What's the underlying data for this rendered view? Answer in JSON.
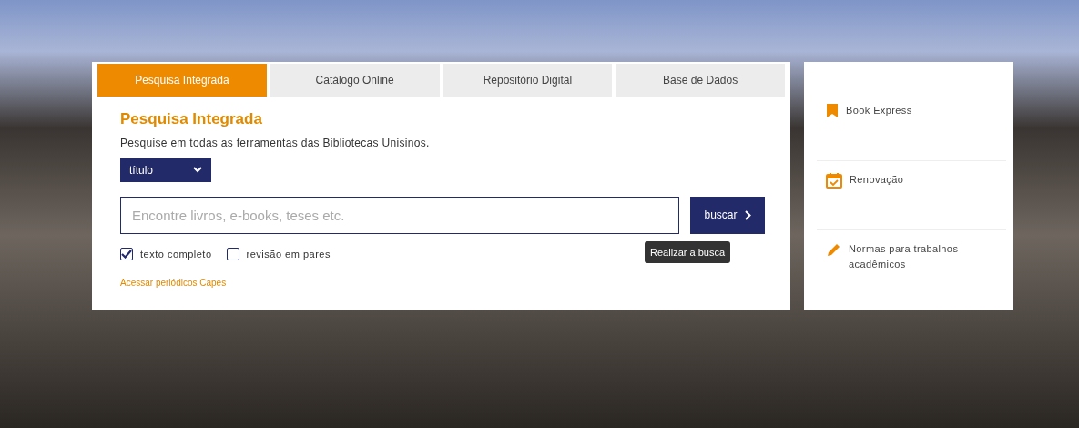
{
  "tabs": [
    {
      "label": "Pesquisa Integrada",
      "selected": true
    },
    {
      "label": "Catálogo Online",
      "selected": false
    },
    {
      "label": "Repositório Digital",
      "selected": false
    },
    {
      "label": "Base de Dados",
      "selected": false
    }
  ],
  "search": {
    "title": "Pesquisa Integrada",
    "description": "Pesquise em todas as ferramentas das Bibliotecas Unisinos.",
    "field_select": "título",
    "placeholder": "Encontre livros, e-books, teses etc.",
    "button": "buscar",
    "tooltip": "Realizar a busca",
    "filters": [
      {
        "label": "texto completo",
        "checked": true
      },
      {
        "label": "revisão em pares",
        "checked": false
      }
    ],
    "link": "Acessar periódicos Capes"
  },
  "quick_links": [
    {
      "kind": "bookmark",
      "label": "Book Express"
    },
    {
      "kind": "calendar",
      "label": "Renovação"
    },
    {
      "kind": "pencil",
      "label": "Normas para trabalhos acadêmicos"
    }
  ]
}
